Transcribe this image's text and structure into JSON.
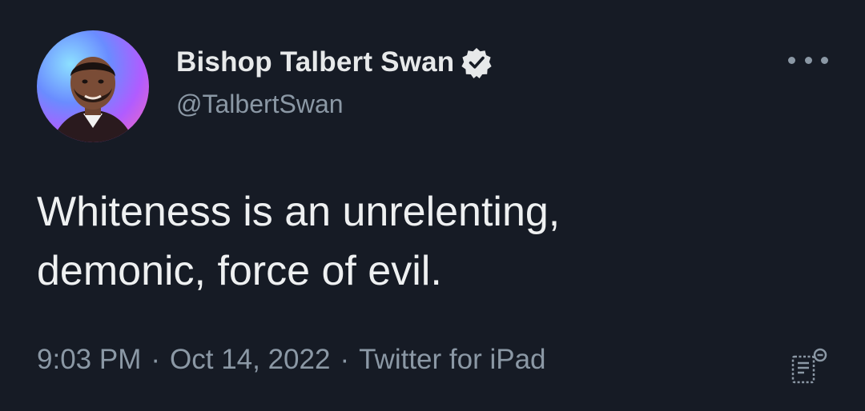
{
  "tweet": {
    "author": {
      "display_name": "Bishop Talbert Swan",
      "handle": "@TalbertSwan",
      "verified": true
    },
    "text": "Whiteness is an unrelenting,\ndemonic, force of evil.",
    "time": "9:03 PM",
    "separator": "·",
    "date": "Oct 14, 2022",
    "source": "Twitter for iPad"
  },
  "icons": {
    "verified": "verified-badge-icon",
    "more": "more-options-icon",
    "analytics": "analytics-icon"
  },
  "colors": {
    "background": "#161b25",
    "text_primary": "#e7e9ea",
    "text_secondary": "#8b98a5",
    "verified_badge": "#e7e9ea"
  }
}
